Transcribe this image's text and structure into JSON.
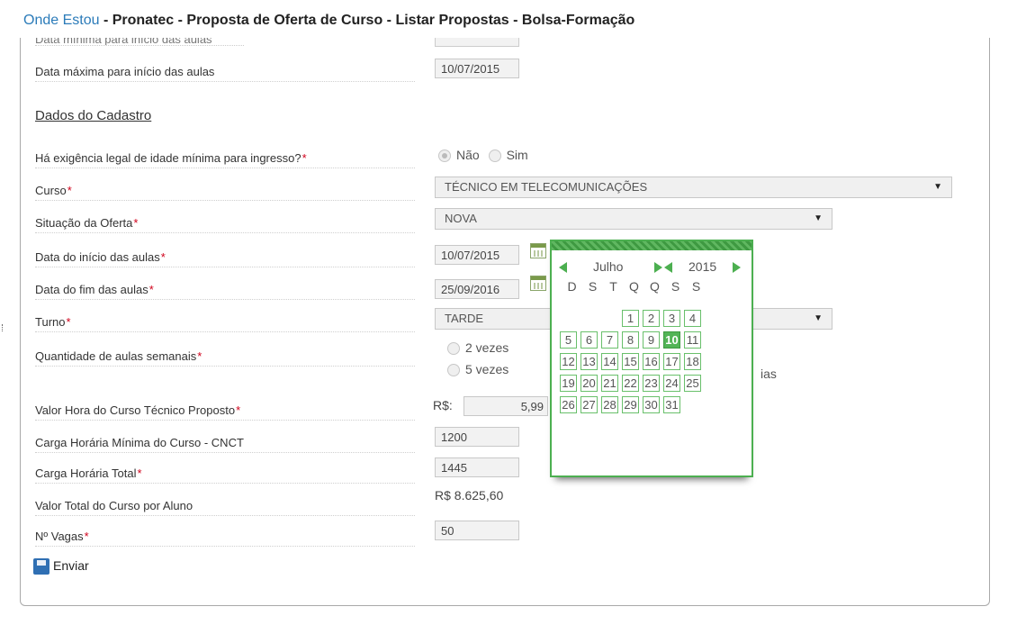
{
  "breadcrumb": {
    "here": "Onde Estou",
    "path": " - Pronatec - Proposta de Oferta de Curso - Listar Propostas - Bolsa-Formação"
  },
  "form": {
    "cut_label": "Data mínima para início das aulas",
    "max_start_label": "Data máxima para início das aulas",
    "max_start_value": "10/07/2015",
    "section_title": "Dados do Cadastro",
    "req_mark": "*",
    "age_label": "Há exigência legal de idade mínima para ingresso?",
    "age_no": "Não",
    "age_yes": "Sim",
    "curso_label": "Curso",
    "curso_value": "TÉCNICO EM TELECOMUNICAÇÕES",
    "situacao_label": "Situação da Oferta",
    "situacao_value": "NOVA",
    "inicio_label": "Data do início das aulas",
    "inicio_value": "10/07/2015",
    "fim_label": "Data do fim das aulas",
    "fim_value": "25/09/2016",
    "turno_label": "Turno",
    "turno_value": "TARDE",
    "aulas_label": "Quantidade de aulas semanais",
    "aulas_opt1": "2 vezes",
    "aulas_opt2": "5 vezes",
    "aulas_opt_partial": "ias",
    "valor_hora_label": "Valor Hora do Curso Técnico Proposto",
    "currency_symbol": "R$:",
    "valor_hora_value": "5,99",
    "carga_min_label": "Carga Horária Mínima do Curso - CNCT",
    "carga_min_value": "1200",
    "carga_total_label": "Carga Horária Total",
    "carga_total_value": "1445",
    "valor_total_label": "Valor Total do Curso por Aluno",
    "valor_total_value": "R$ 8.625,60",
    "vagas_label": "Nº Vagas",
    "vagas_value": "50",
    "submit_label": "Enviar"
  },
  "calendar": {
    "month": "Julho",
    "year": "2015",
    "weekdays": [
      "D",
      "S",
      "T",
      "Q",
      "Q",
      "S",
      "S"
    ],
    "selected_day": 10,
    "accent": "#4caf50"
  }
}
